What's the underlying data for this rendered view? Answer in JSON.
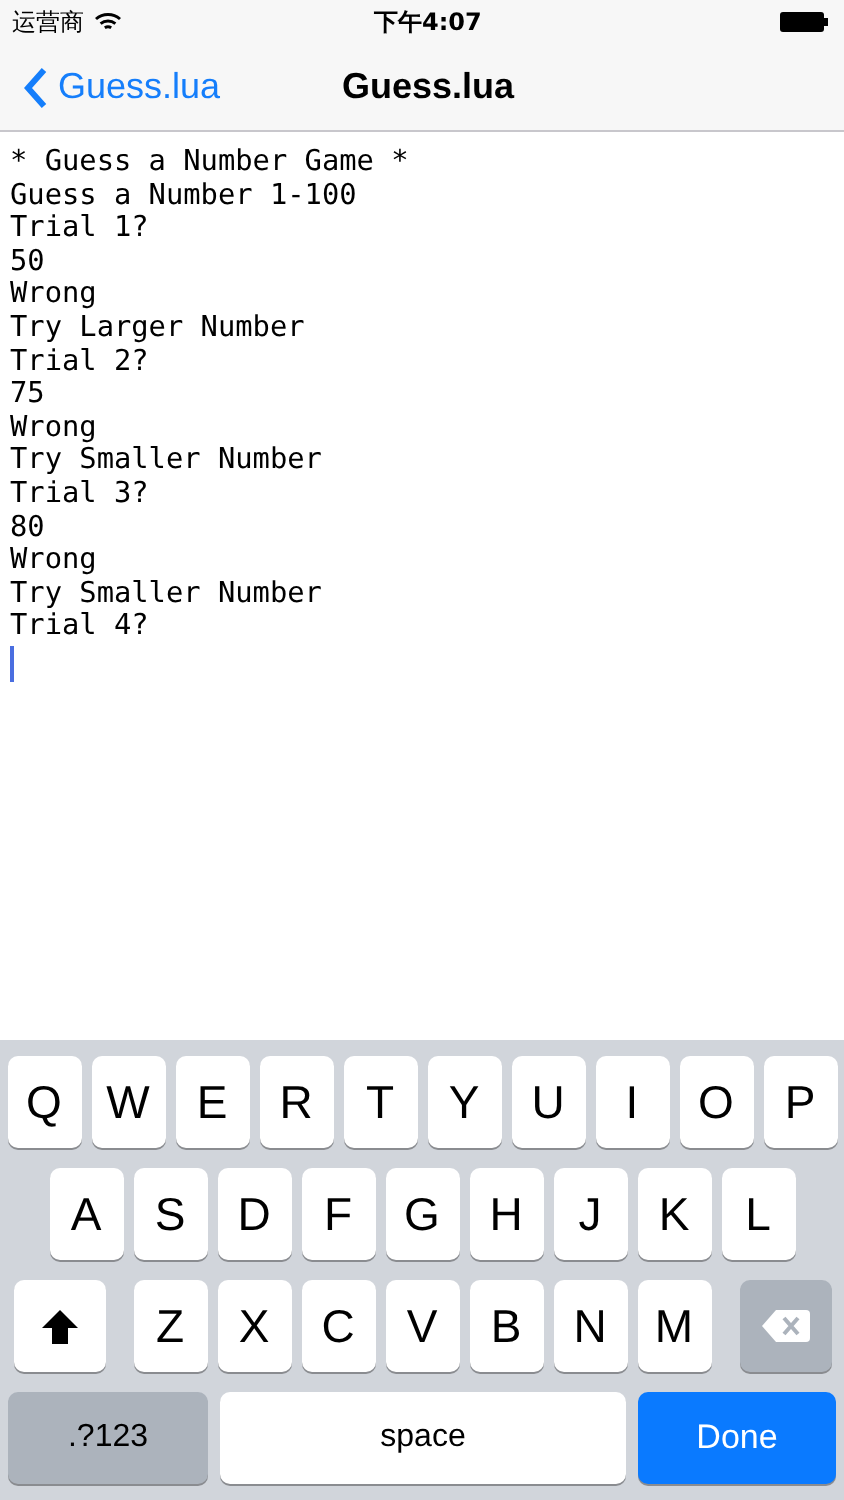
{
  "status_bar": {
    "carrier": "运营商",
    "time": "下午4:07"
  },
  "nav": {
    "back_label": "Guess.lua",
    "title": "Guess.lua"
  },
  "console": {
    "lines": [
      "* Guess a Number Game *",
      "Guess a Number 1-100",
      "Trial 1?",
      "50",
      "Wrong",
      "Try Larger Number",
      "Trial 2?",
      "75",
      "Wrong",
      "Try Smaller Number",
      "Trial 3?",
      "80",
      "Wrong",
      "Try Smaller Number",
      "Trial 4?"
    ]
  },
  "keyboard": {
    "rows": [
      [
        {
          "kind": "letter",
          "label": "Q"
        },
        {
          "kind": "letter",
          "label": "W"
        },
        {
          "kind": "letter",
          "label": "E"
        },
        {
          "kind": "letter",
          "label": "R"
        },
        {
          "kind": "letter",
          "label": "T"
        },
        {
          "kind": "letter",
          "label": "Y"
        },
        {
          "kind": "letter",
          "label": "U"
        },
        {
          "kind": "letter",
          "label": "I"
        },
        {
          "kind": "letter",
          "label": "O"
        },
        {
          "kind": "letter",
          "label": "P"
        }
      ],
      [
        {
          "kind": "letter",
          "label": "A"
        },
        {
          "kind": "letter",
          "label": "S"
        },
        {
          "kind": "letter",
          "label": "D"
        },
        {
          "kind": "letter",
          "label": "F"
        },
        {
          "kind": "letter",
          "label": "G"
        },
        {
          "kind": "letter",
          "label": "H"
        },
        {
          "kind": "letter",
          "label": "J"
        },
        {
          "kind": "letter",
          "label": "K"
        },
        {
          "kind": "letter",
          "label": "L"
        }
      ],
      [
        {
          "kind": "shift"
        },
        {
          "kind": "letter",
          "label": "Z"
        },
        {
          "kind": "letter",
          "label": "X"
        },
        {
          "kind": "letter",
          "label": "C"
        },
        {
          "kind": "letter",
          "label": "V"
        },
        {
          "kind": "letter",
          "label": "B"
        },
        {
          "kind": "letter",
          "label": "N"
        },
        {
          "kind": "letter",
          "label": "M"
        },
        {
          "kind": "delete"
        }
      ]
    ],
    "numbers_key": ".?123",
    "space_key": "space",
    "done_key": "Done"
  }
}
